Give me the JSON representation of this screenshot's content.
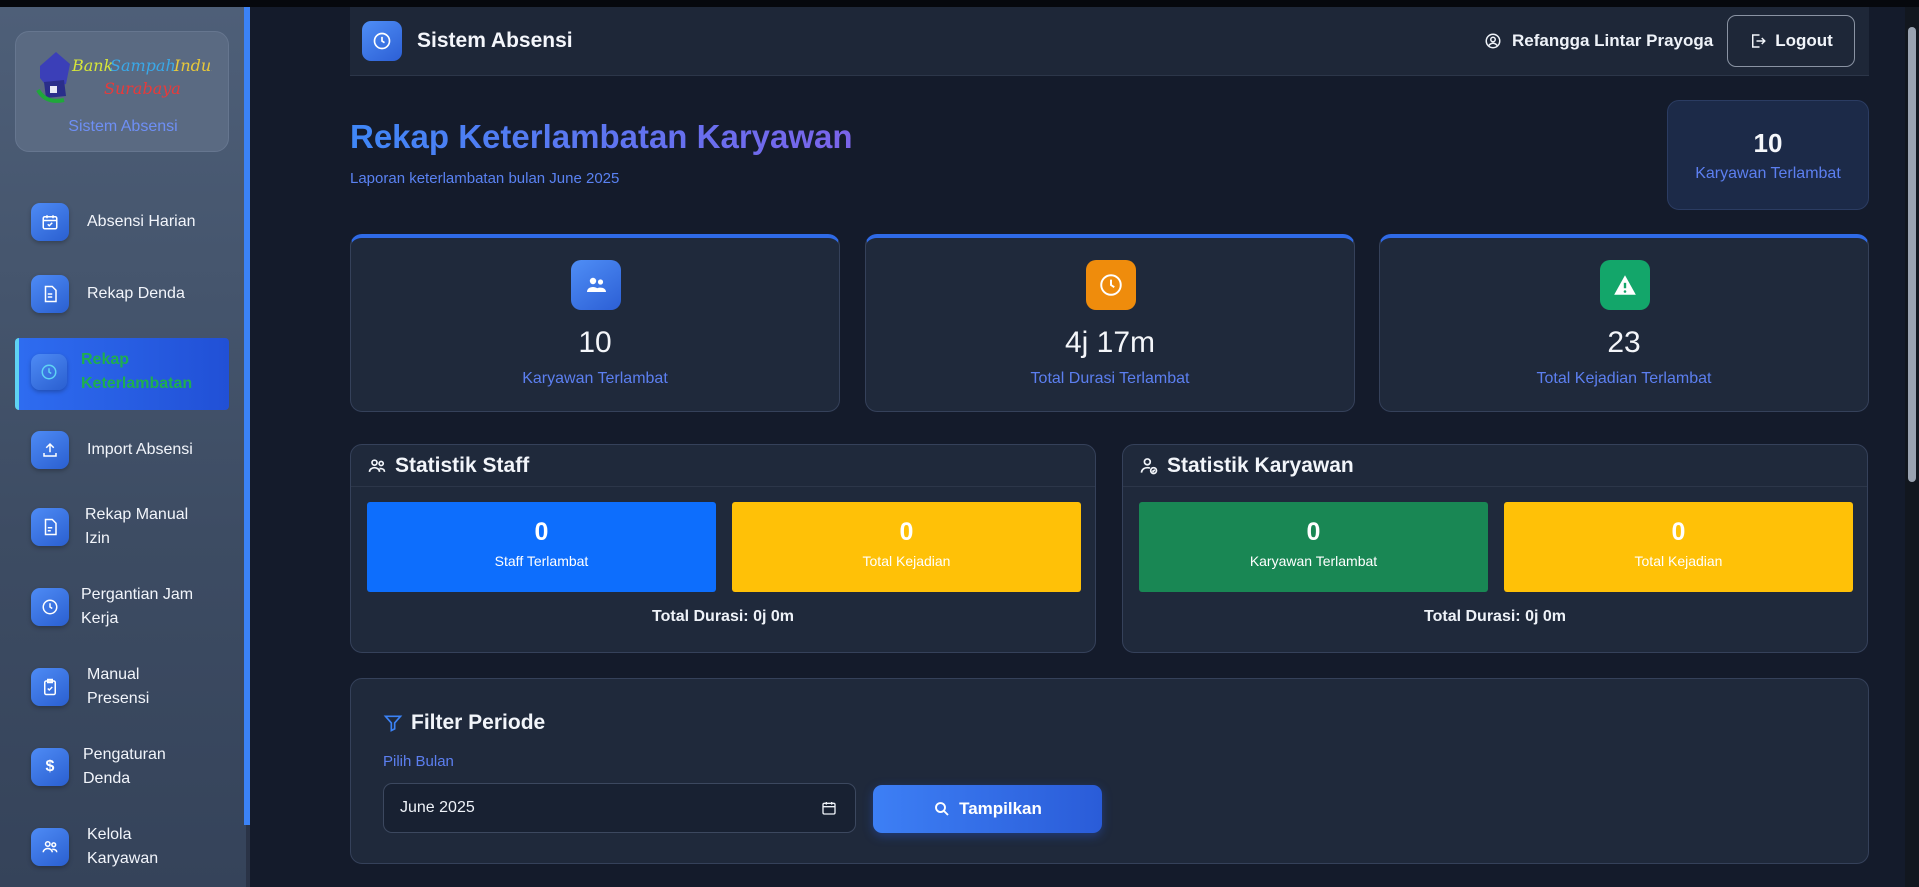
{
  "sidebar": {
    "logo_text": "Bank Sampah Induk Surabaya",
    "subtitle": "Sistem Absensi",
    "items": [
      {
        "label": "Absensi Harian",
        "icon": "calendar-check-icon"
      },
      {
        "label": "Rekap Denda",
        "icon": "document-icon"
      },
      {
        "label": "Rekap Keterlambatan",
        "icon": "clock-icon",
        "active": true
      },
      {
        "label": "Import Absensi",
        "icon": "upload-icon"
      },
      {
        "label": "Rekap Manual Izin",
        "icon": "file-icon"
      },
      {
        "label": "Pergantian Jam Kerja",
        "icon": "clock-icon"
      },
      {
        "label": "Manual Presensi",
        "icon": "clipboard-icon"
      },
      {
        "label": "Pengaturan Denda",
        "icon": "dollar-icon"
      },
      {
        "label": "Kelola Karyawan",
        "icon": "users-icon"
      }
    ]
  },
  "header": {
    "title": "Sistem Absensi",
    "user_name": "Refangga Lintar Prayoga",
    "logout_label": "Logout"
  },
  "page": {
    "title": "Rekap Keterlambatan Karyawan",
    "subtitle": "Laporan keterlambatan bulan June 2025",
    "badge": {
      "value": "10",
      "label": "Karyawan Terlambat"
    }
  },
  "stats": [
    {
      "value": "10",
      "label": "Karyawan Terlambat",
      "icon": "users-icon",
      "color": "#2f6ae6"
    },
    {
      "value": "4j 17m",
      "label": "Total Durasi Terlambat",
      "icon": "clock-icon",
      "color": "#ef8c0c"
    },
    {
      "value": "23",
      "label": "Total Kejadian Terlambat",
      "icon": "warning-icon",
      "color": "#13a66a"
    }
  ],
  "staff_panel": {
    "title": "Statistik Staff",
    "boxes": [
      {
        "value": "0",
        "label": "Staff Terlambat",
        "color": "#0d6efd"
      },
      {
        "value": "0",
        "label": "Total Kejadian",
        "color": "#ffc107"
      }
    ],
    "total": "Total Durasi: 0j 0m"
  },
  "employee_panel": {
    "title": "Statistik Karyawan",
    "boxes": [
      {
        "value": "0",
        "label": "Karyawan Terlambat",
        "color": "#198754"
      },
      {
        "value": "0",
        "label": "Total Kejadian",
        "color": "#ffc107"
      }
    ],
    "total": "Total Durasi: 0j 0m"
  },
  "filter": {
    "title": "Filter Periode",
    "month_label": "Pilih Bulan",
    "month_value": "June 2025",
    "button_label": "Tampilkan"
  }
}
